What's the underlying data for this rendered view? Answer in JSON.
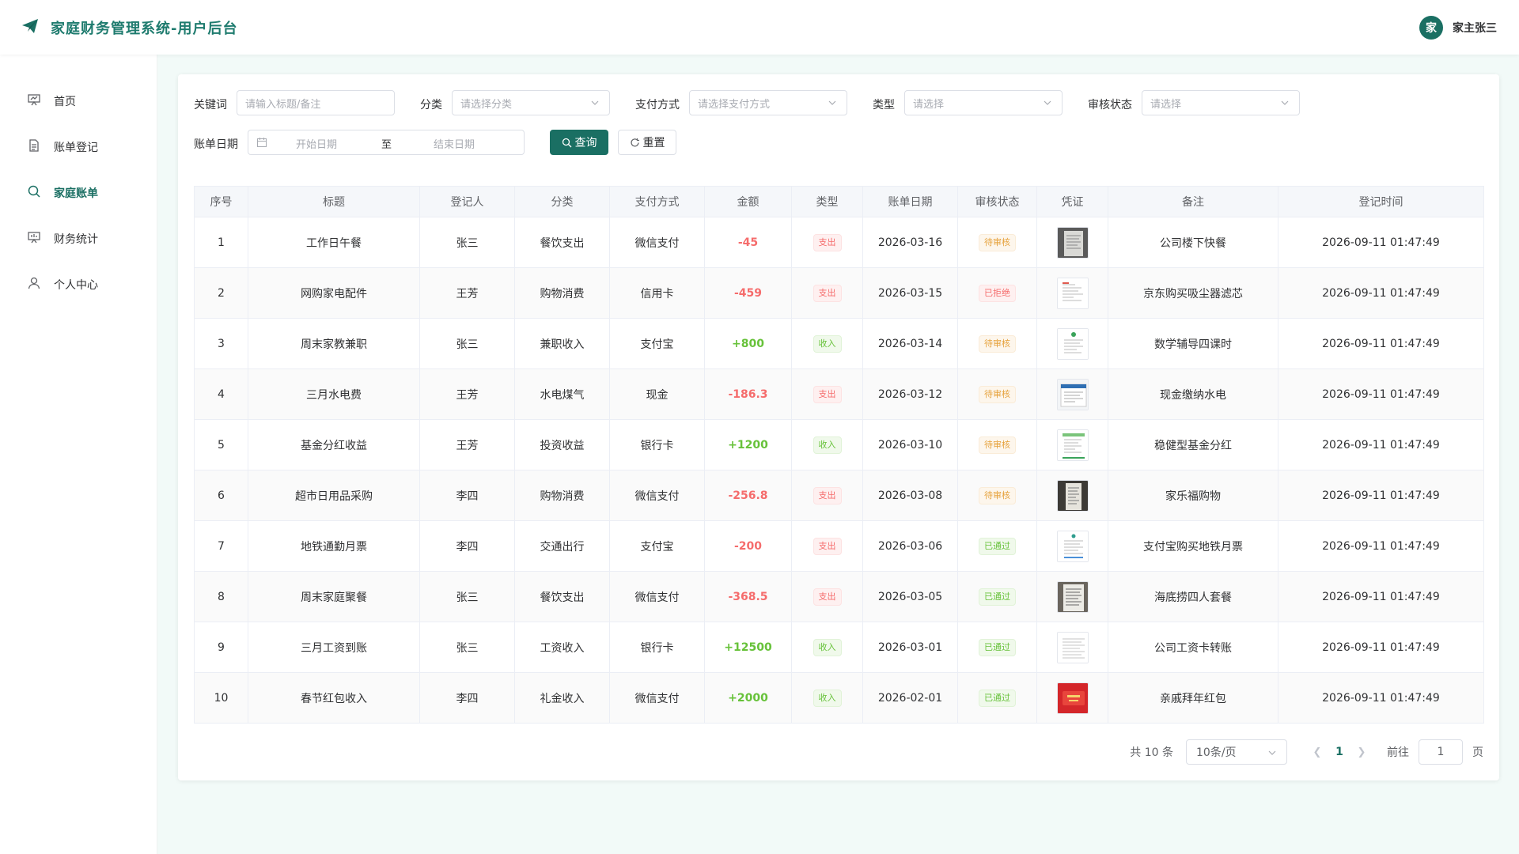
{
  "header": {
    "title": "家庭财务管理系统-用户后台",
    "avatar_text": "家",
    "user_name": "家主张三"
  },
  "sidebar": {
    "items": [
      {
        "label": "首页",
        "icon": "dashboard-icon"
      },
      {
        "label": "账单登记",
        "icon": "document-icon"
      },
      {
        "label": "家庭账单",
        "icon": "search-icon"
      },
      {
        "label": "财务统计",
        "icon": "chart-board-icon"
      },
      {
        "label": "个人中心",
        "icon": "user-icon"
      }
    ],
    "active_index": 2
  },
  "filters": {
    "keyword_label": "关键词",
    "keyword_placeholder": "请输入标题/备注",
    "category_label": "分类",
    "category_placeholder": "请选择分类",
    "payment_label": "支付方式",
    "payment_placeholder": "请选择支付方式",
    "type_label": "类型",
    "type_placeholder": "请选择",
    "status_label": "审核状态",
    "status_placeholder": "请选择",
    "date_label": "账单日期",
    "date_start_placeholder": "开始日期",
    "date_separator": "至",
    "date_end_placeholder": "结束日期",
    "query_button": "查询",
    "reset_button": "重置"
  },
  "table": {
    "columns": [
      "序号",
      "标题",
      "登记人",
      "分类",
      "支付方式",
      "金额",
      "类型",
      "账单日期",
      "审核状态",
      "凭证",
      "备注",
      "登记时间"
    ],
    "rows": [
      {
        "no": "1",
        "title": "工作日午餐",
        "user": "张三",
        "category": "餐饮支出",
        "payment": "微信支付",
        "amount": "-45",
        "type": "支出",
        "date": "2026-03-16",
        "status": "待审核",
        "note": "公司楼下快餐",
        "created": "2026-09-11 01:47:49"
      },
      {
        "no": "2",
        "title": "网购家电配件",
        "user": "王芳",
        "category": "购物消费",
        "payment": "信用卡",
        "amount": "-459",
        "type": "支出",
        "date": "2026-03-15",
        "status": "已拒绝",
        "note": "京东购买吸尘器滤芯",
        "created": "2026-09-11 01:47:49"
      },
      {
        "no": "3",
        "title": "周末家教兼职",
        "user": "张三",
        "category": "兼职收入",
        "payment": "支付宝",
        "amount": "+800",
        "type": "收入",
        "date": "2026-03-14",
        "status": "待审核",
        "note": "数学辅导四课时",
        "created": "2026-09-11 01:47:49"
      },
      {
        "no": "4",
        "title": "三月水电费",
        "user": "王芳",
        "category": "水电煤气",
        "payment": "现金",
        "amount": "-186.3",
        "type": "支出",
        "date": "2026-03-12",
        "status": "待审核",
        "note": "现金缴纳水电",
        "created": "2026-09-11 01:47:49"
      },
      {
        "no": "5",
        "title": "基金分红收益",
        "user": "王芳",
        "category": "投资收益",
        "payment": "银行卡",
        "amount": "+1200",
        "type": "收入",
        "date": "2026-03-10",
        "status": "待审核",
        "note": "稳健型基金分红",
        "created": "2026-09-11 01:47:49"
      },
      {
        "no": "6",
        "title": "超市日用品采购",
        "user": "李四",
        "category": "购物消费",
        "payment": "微信支付",
        "amount": "-256.8",
        "type": "支出",
        "date": "2026-03-08",
        "status": "待审核",
        "note": "家乐福购物",
        "created": "2026-09-11 01:47:49"
      },
      {
        "no": "7",
        "title": "地铁通勤月票",
        "user": "李四",
        "category": "交通出行",
        "payment": "支付宝",
        "amount": "-200",
        "type": "支出",
        "date": "2026-03-06",
        "status": "已通过",
        "note": "支付宝购买地铁月票",
        "created": "2026-09-11 01:47:49"
      },
      {
        "no": "8",
        "title": "周末家庭聚餐",
        "user": "张三",
        "category": "餐饮支出",
        "payment": "微信支付",
        "amount": "-368.5",
        "type": "支出",
        "date": "2026-03-05",
        "status": "已通过",
        "note": "海底捞四人套餐",
        "created": "2026-09-11 01:47:49"
      },
      {
        "no": "9",
        "title": "三月工资到账",
        "user": "张三",
        "category": "工资收入",
        "payment": "银行卡",
        "amount": "+12500",
        "type": "收入",
        "date": "2026-03-01",
        "status": "已通过",
        "note": "公司工资卡转账",
        "created": "2026-09-11 01:47:49"
      },
      {
        "no": "10",
        "title": "春节红包收入",
        "user": "李四",
        "category": "礼金收入",
        "payment": "微信支付",
        "amount": "+2000",
        "type": "收入",
        "date": "2026-02-01",
        "status": "已通过",
        "note": "亲戚拜年红包",
        "created": "2026-09-11 01:47:49"
      }
    ]
  },
  "pagination": {
    "total_text": "共 10 条",
    "page_size": "10条/页",
    "current_page": "1",
    "goto_label": "前往",
    "goto_value": "1",
    "page_unit": "页"
  },
  "colors": {
    "brand": "#1a6f63",
    "expense": "#f56c6c",
    "income": "#67c23a",
    "pending": "#e6a23c"
  }
}
